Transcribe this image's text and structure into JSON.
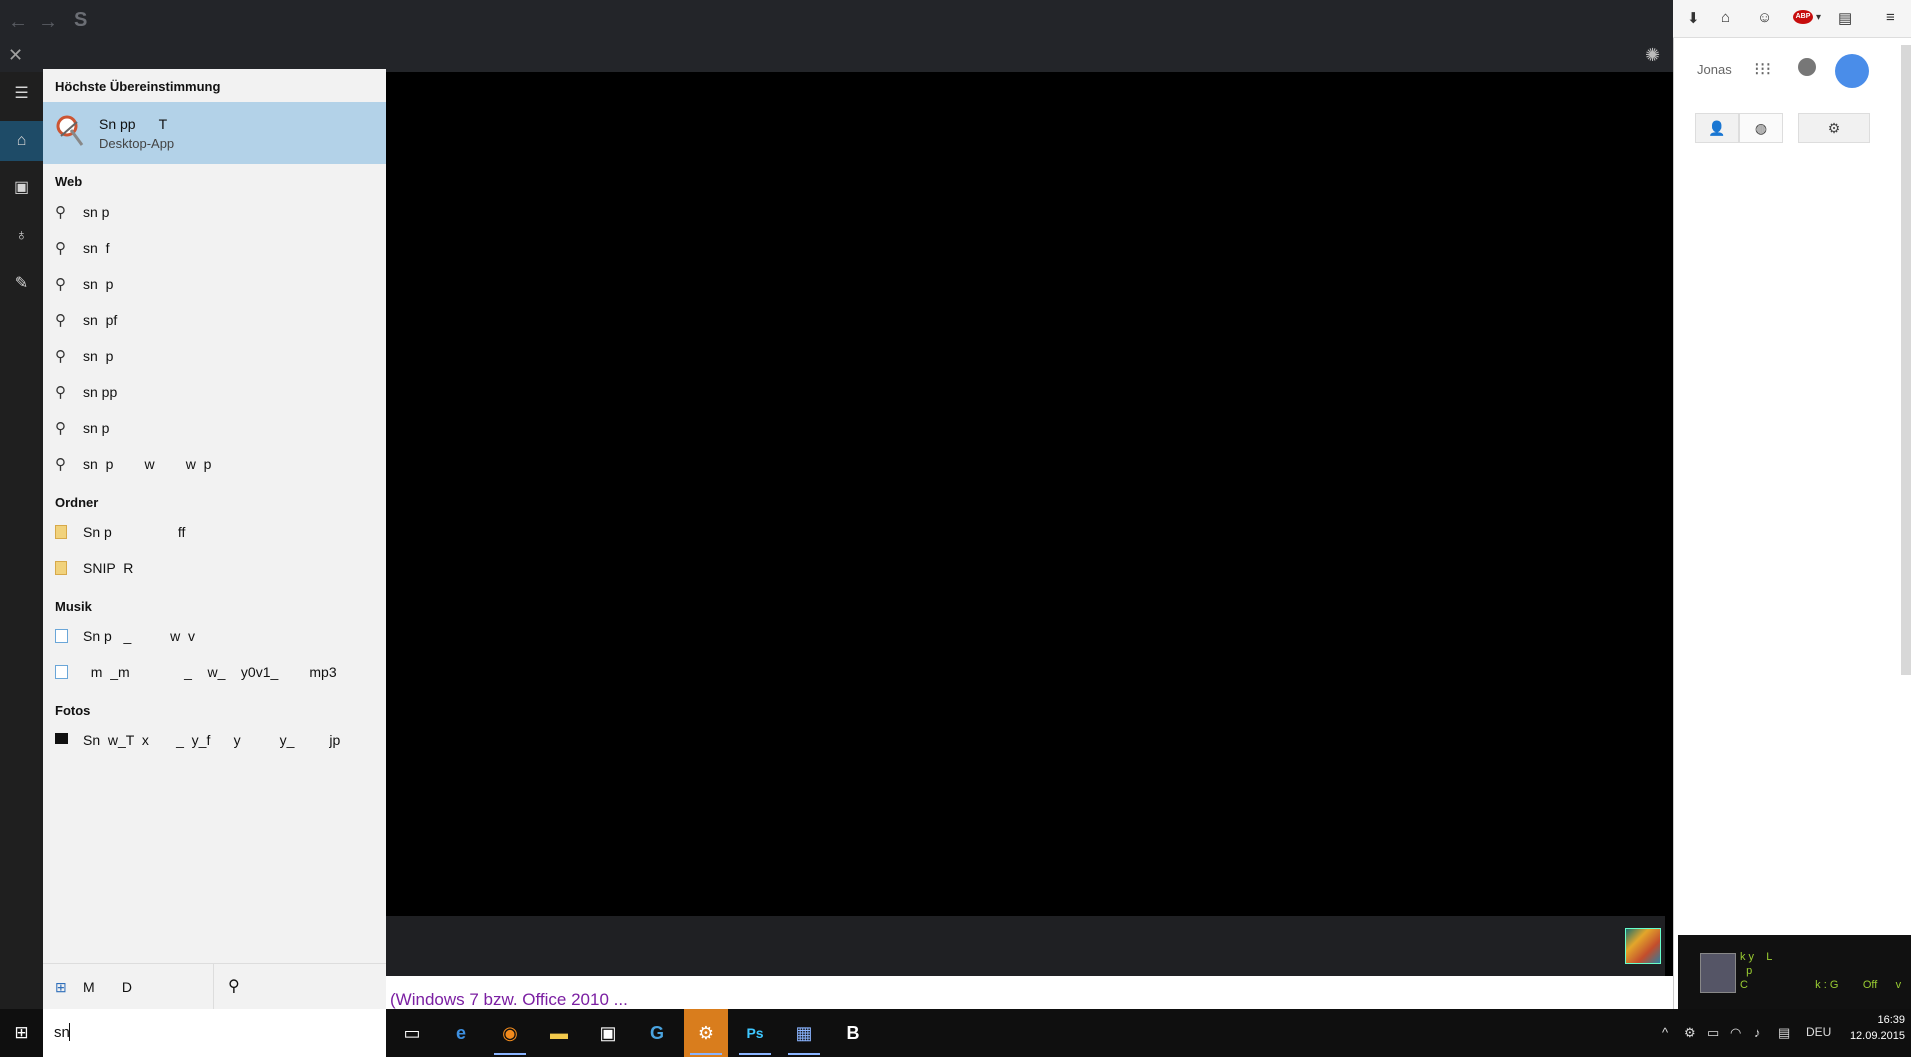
{
  "browser": {
    "back_glyph": "←",
    "forward_glyph": "→",
    "site_glyph": "S",
    "close_glyph": "✕",
    "loading_glyph": "✺"
  },
  "video_area": {
    "link_text": "(Windows 7 bzw. Office 2010 ..."
  },
  "right_panel": {
    "toolbar_icons": [
      "download-icon",
      "home-icon",
      "chat-icon",
      "abp-icon",
      "reader-icon",
      "menu-icon"
    ],
    "abp_label": "ABP",
    "user_name": "Jonas",
    "tabs": [
      "person",
      "globe",
      "settings"
    ],
    "chat": {
      "line1": "k y    L",
      "line2": "  p",
      "line3": "C                      k : G        Off      v"
    }
  },
  "left_rail": {
    "menu_glyph": "☰",
    "items": [
      "home-icon",
      "notebook-icon",
      "lightbulb-icon",
      "feedback-icon"
    ]
  },
  "search_panel": {
    "best_match_header": "Höchste Übereinstimmung",
    "best_match": {
      "title": "Sn pp      T",
      "subtitle": "Desktop-App"
    },
    "web_header": "Web",
    "web_items": [
      "sn p",
      "sn  f",
      "sn  p",
      "sn  pf",
      "sn  p",
      "sn pp",
      "sn p",
      "sn  p        w        w  p"
    ],
    "folders_header": "Ordner",
    "folder_items": [
      "Sn p                 ff",
      "SNIP  R"
    ],
    "music_header": "Musik",
    "music_items": [
      "Sn p   _          w  v",
      "  m  _m              _    w_    y0v1_        mp3"
    ],
    "photos_header": "Fotos",
    "photo_items": [
      "Sn  w_T  x       _  y_f      y          y_         jp"
    ],
    "footer": {
      "my_stuff_label": "M       D"
    }
  },
  "taskbar": {
    "search_value": "sn",
    "start_glyph": "⊞",
    "apps": [
      {
        "name": "task-view-icon",
        "glyph": "▭"
      },
      {
        "name": "edge-icon",
        "glyph": "e"
      },
      {
        "name": "firefox-icon",
        "glyph": "◉"
      },
      {
        "name": "explorer-icon",
        "glyph": "▬"
      },
      {
        "name": "store-icon",
        "glyph": "▣"
      },
      {
        "name": "g-app-icon",
        "glyph": "G"
      },
      {
        "name": "steam-icon",
        "glyph": "⚙"
      },
      {
        "name": "photoshop-icon",
        "glyph": "Ps"
      },
      {
        "name": "window-app-icon",
        "glyph": "▦"
      },
      {
        "name": "b-app-icon",
        "glyph": "B"
      }
    ],
    "tray": {
      "chevron": "^",
      "language": "DEU",
      "time": "16:39",
      "date": "12.09.2015"
    }
  },
  "colors": {
    "accent_blue": "#1e4b67",
    "best_match_bg": "#b3d2e8",
    "steam_bg": "#d97d1d",
    "link_purple": "#7b1fa2"
  }
}
